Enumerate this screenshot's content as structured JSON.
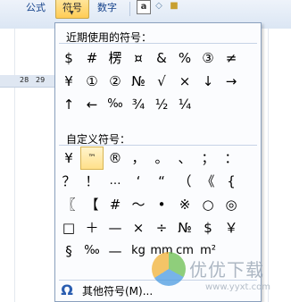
{
  "ribbon": {
    "tabs": [
      "公式",
      "符号",
      "数字"
    ],
    "active_tab": "符号",
    "icons": [
      "text-box-icon",
      "eraser-icon",
      "lock-icon"
    ]
  },
  "sheet": {
    "ruler_numbers": [
      "28",
      "29"
    ]
  },
  "panel": {
    "recent_title": "近期使用的符号：",
    "recent_symbols": [
      "$",
      "#",
      "楞",
      "¤",
      "&",
      "%",
      "③",
      "≠",
      "¥",
      "①",
      "②",
      "№",
      "√",
      "×",
      "↓",
      "→",
      "↑",
      "←",
      "‰",
      "¾",
      "½",
      "¼"
    ],
    "custom_title": "自定义符号：",
    "custom_symbols": [
      "¥",
      "™",
      "®",
      "，",
      "。",
      "、",
      "；",
      "：",
      "？",
      "！",
      "…",
      "‘",
      "“",
      "（",
      "《",
      "{",
      "〖",
      "【",
      "#",
      "～",
      "•",
      "※",
      "○",
      "◎",
      "□",
      "＋",
      "—",
      "×",
      "÷",
      "№",
      "$",
      "￥",
      "§",
      "‰",
      "—",
      "kg",
      "mm",
      "cm",
      "m²",
      ""
    ],
    "selected_custom_index": 1,
    "more_label": "其他符号(M)..."
  },
  "watermark": {
    "text": "优优下载",
    "url": "www.yyxt.com"
  }
}
